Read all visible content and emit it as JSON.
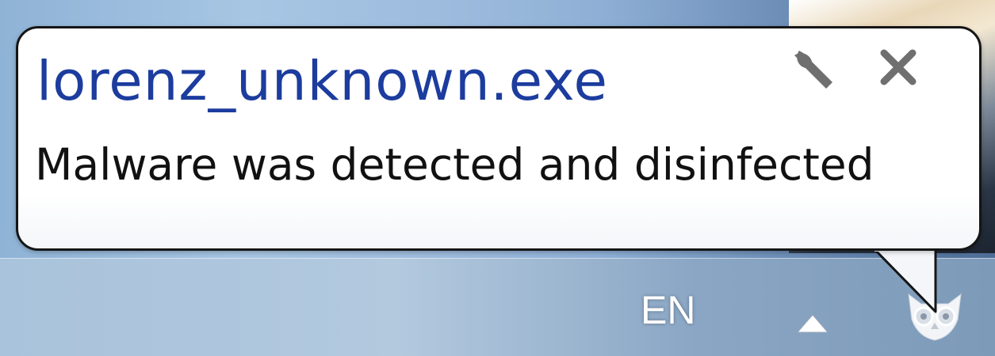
{
  "notification": {
    "title": "lorenz_unknown.exe",
    "message": "Malware was detected and disinfected",
    "title_color": "#1c3c9e"
  },
  "taskbar": {
    "language": "EN"
  },
  "icons": {
    "settings": "wrench-icon",
    "close": "close-icon",
    "tray_overflow": "triangle-up-icon",
    "antivirus": "owl-icon"
  }
}
